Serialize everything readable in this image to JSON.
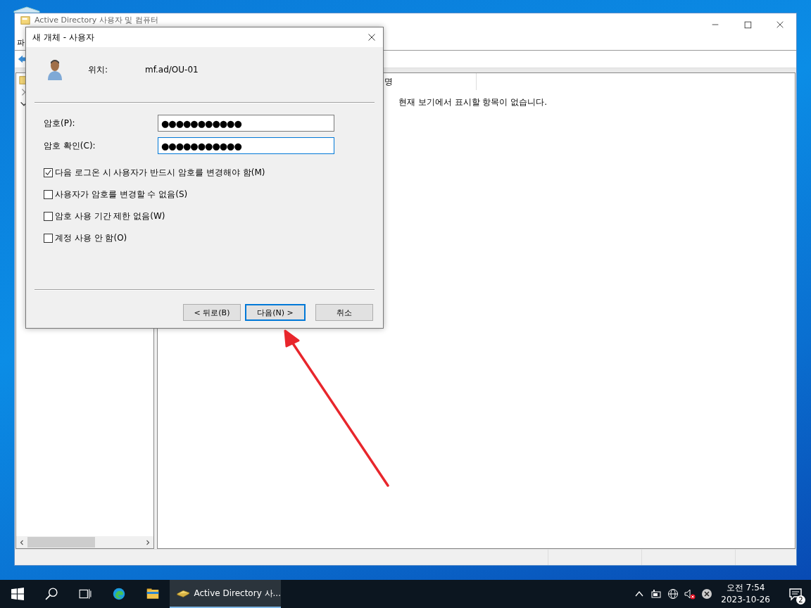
{
  "background_window": {
    "title": "Active Directory 사용자 및 컴퓨터",
    "menu": [
      "파"
    ],
    "list": {
      "columns": [
        "명"
      ],
      "empty_message": "현재 보기에서 표시할 항목이 없습니다."
    }
  },
  "dialog": {
    "title": "새 개체 - 사용자",
    "location_label": "위치:",
    "location": "mf.ad/OU-01",
    "fields": [
      {
        "label": "암호(P):",
        "value": "●●●●●●●●●●●",
        "focused": false
      },
      {
        "label": "암호 확인(C):",
        "value": "●●●●●●●●●●●",
        "focused": true
      }
    ],
    "options": [
      {
        "label": "다음 로그온 시 사용자가 반드시 암호를 변경해야 함(M)",
        "checked": true
      },
      {
        "label": "사용자가 암호를 변경할 수 없음(S)",
        "checked": false
      },
      {
        "label": "암호 사용 기간 제한 없음(W)",
        "checked": false
      },
      {
        "label": "계정 사용 안 함(O)",
        "checked": false
      }
    ],
    "buttons": [
      {
        "label": "< 뒤로(B)",
        "default": false
      },
      {
        "label": "다음(N) >",
        "default": true
      },
      {
        "label": "취소",
        "default": false
      }
    ]
  },
  "taskbar": {
    "apps": [
      {
        "label": "Active Directory 사...",
        "selected": true
      }
    ],
    "clock": {
      "time": "오전 7:54",
      "date": "2023-10-26"
    },
    "notification_count": "2"
  }
}
